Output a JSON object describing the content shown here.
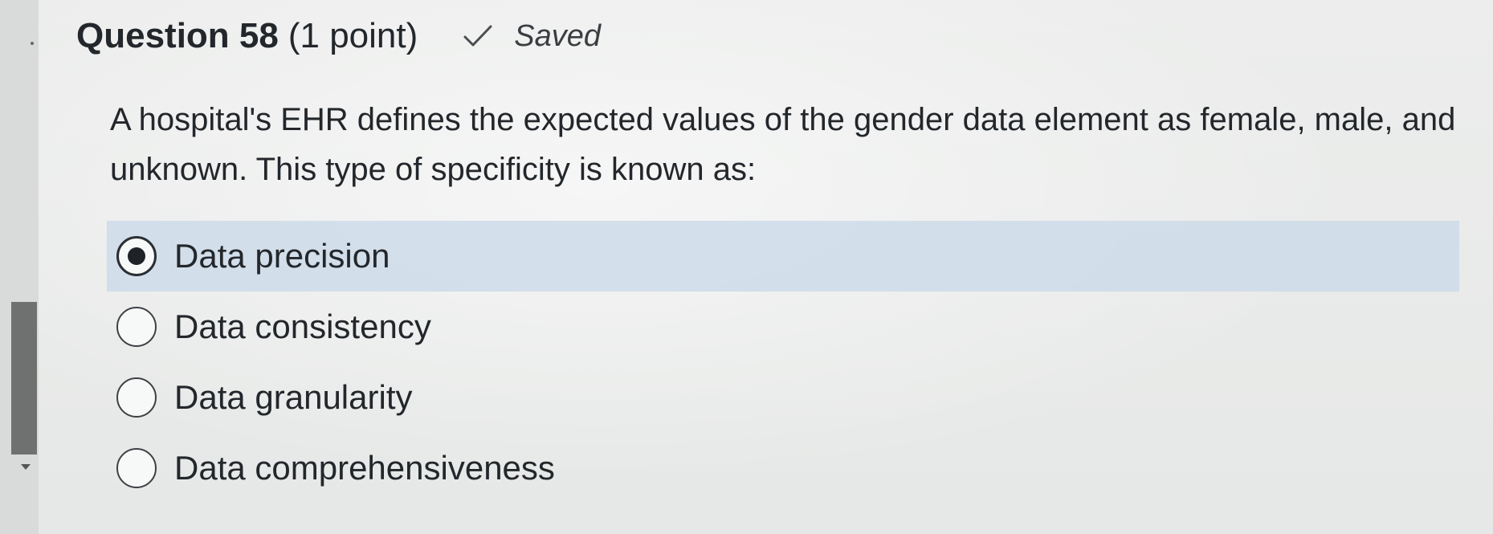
{
  "question": {
    "title": "Question 58",
    "points": "(1 point)",
    "status": "Saved",
    "text": "A hospital's EHR defines the expected values of the gender data element as female, male, and unknown. This type of specificity is known as:"
  },
  "options": [
    {
      "label": "Data precision",
      "selected": true
    },
    {
      "label": "Data consistency",
      "selected": false
    },
    {
      "label": "Data granularity",
      "selected": false
    },
    {
      "label": "Data comprehensiveness",
      "selected": false
    }
  ],
  "icons": {
    "status": "check-icon"
  }
}
